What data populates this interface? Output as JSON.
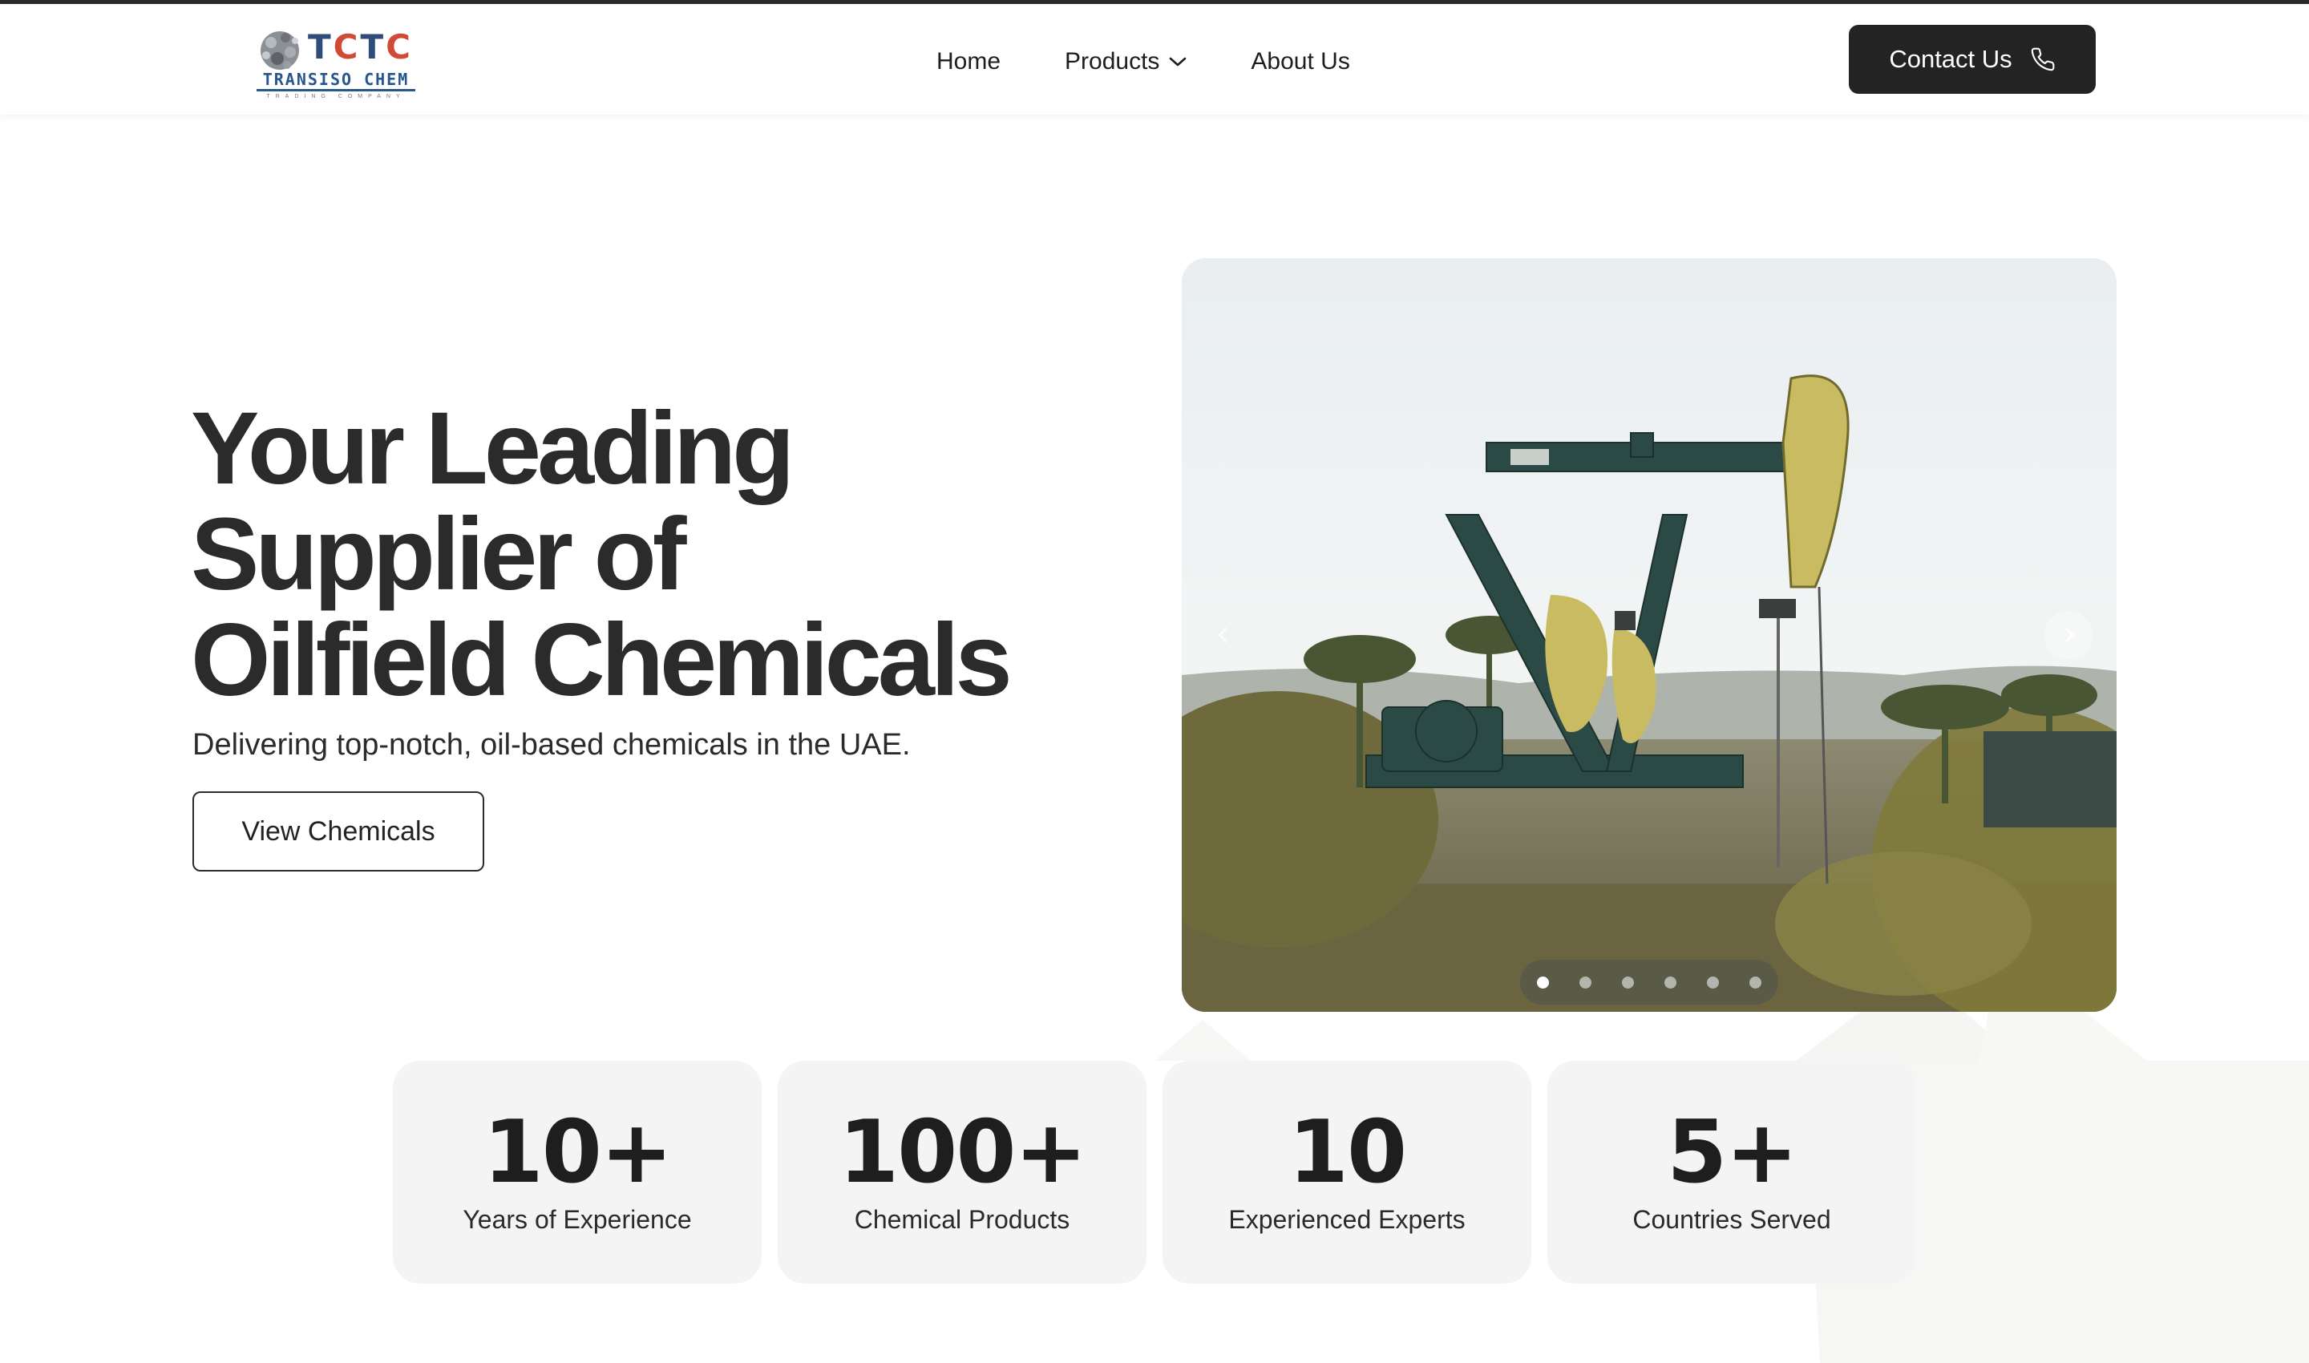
{
  "navbar": {
    "logo": {
      "brand": "TCTC",
      "brand_parts": [
        "T",
        "C",
        "T",
        "C"
      ],
      "name": "TRANSISO CHEM",
      "tagline": "TRADING COMPANY"
    },
    "links": [
      {
        "label": "Home"
      },
      {
        "label": "Products",
        "icon": "chevron-down-icon"
      },
      {
        "label": "About Us"
      }
    ],
    "contact": {
      "label": "Contact Us",
      "icon": "phone-icon"
    }
  },
  "hero": {
    "title_lines": [
      "Your Leading",
      "Supplier of",
      "Oilfield Chemicals"
    ],
    "subtitle": "Delivering top-notch, oil-based chemicals in the UAE.",
    "cta": "View Chemicals"
  },
  "carousel": {
    "image": "oil pumpjack with palm trees",
    "slide_count": 6,
    "active_index": 0,
    "prev_icon": "chevron-left-icon",
    "next_icon": "chevron-right-icon"
  },
  "stats": [
    {
      "value": "10+",
      "label": "Years of Experience"
    },
    {
      "value": "100+",
      "label": "Chemical Products"
    },
    {
      "value": "10",
      "label": "Experienced Experts"
    },
    {
      "value": "5+",
      "label": "Countries Served"
    }
  ],
  "colors": {
    "dark": "#232323",
    "logo_blue": "#2f4b7a",
    "logo_red": "#d04a36",
    "stat_bg": "#f4f4f4"
  }
}
